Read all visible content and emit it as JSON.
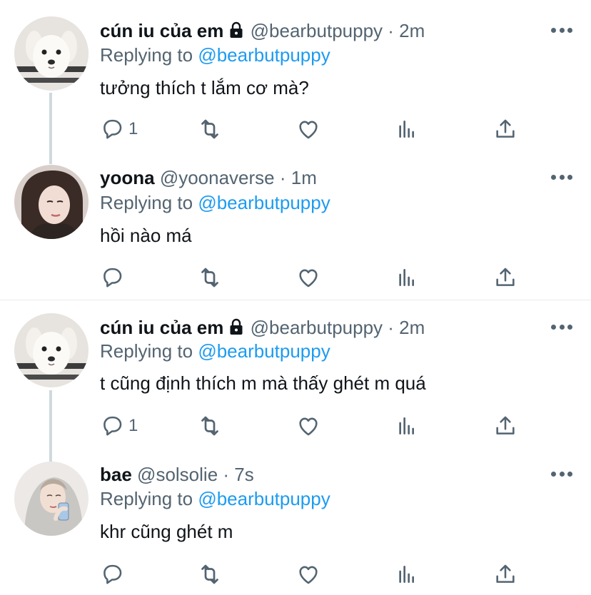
{
  "tweets": [
    {
      "name": "cún iu của em",
      "locked": true,
      "handle_time": "@bearbutpuppy · 2m",
      "replying_label": "Replying to",
      "replying_to": "@bearbutpuppy",
      "text": "tưởng thích t lắm cơ mà?",
      "reply_count": "1",
      "avatar": "puppy-avatar"
    },
    {
      "name": "yoona",
      "locked": false,
      "handle_time": "@yoonaverse · 1m",
      "replying_label": "Replying to",
      "replying_to": "@bearbutpuppy",
      "text": "hồi nào má",
      "reply_count": "",
      "avatar": "girl-avatar"
    },
    {
      "name": "cún iu của em",
      "locked": true,
      "handle_time": "@bearbutpuppy · 2m",
      "replying_label": "Replying to",
      "replying_to": "@bearbutpuppy",
      "text": "t cũng định thích m mà thấy ghét m quá",
      "reply_count": "1",
      "avatar": "puppy-avatar"
    },
    {
      "name": "bae",
      "locked": false,
      "handle_time": "@solsolie · 7s",
      "replying_label": "Replying to",
      "replying_to": "@bearbutpuppy",
      "text": "khr cũng ghét m",
      "reply_count": "",
      "avatar": "hoodie-avatar"
    }
  ],
  "colors": {
    "accent": "#1d9bf0",
    "secondary_text": "#536471",
    "primary_text": "#0f1419",
    "thread_line": "#cfd9de"
  },
  "icons": [
    "reply-icon",
    "retweet-icon",
    "like-icon",
    "analytics-icon",
    "share-icon",
    "more-icon",
    "lock-icon"
  ]
}
